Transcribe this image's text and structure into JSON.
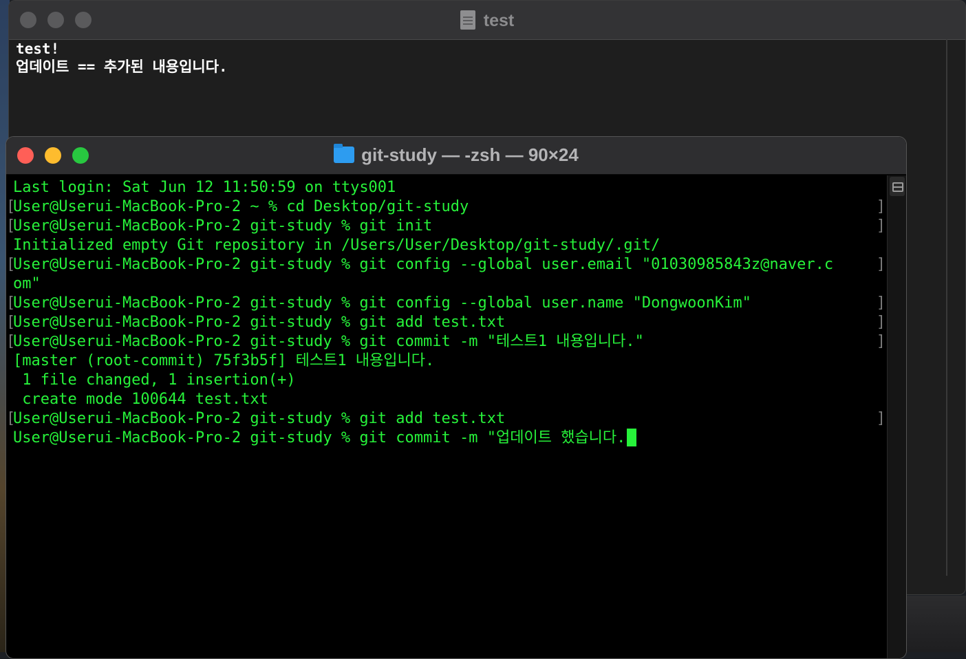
{
  "textedit": {
    "title": "test",
    "lines": [
      "test!",
      "업데이트 == 추가된 내용입니다."
    ]
  },
  "terminal": {
    "title": "git-study — -zsh — 90×24",
    "lines": [
      {
        "text": "Last login: Sat Jun 12 11:50:59 on ttys001",
        "marked": false
      },
      {
        "text": "User@Userui-MacBook-Pro-2 ~ % cd Desktop/git-study",
        "marked": true
      },
      {
        "text": "User@Userui-MacBook-Pro-2 git-study % git init",
        "marked": true
      },
      {
        "text": "Initialized empty Git repository in /Users/User/Desktop/git-study/.git/",
        "marked": false
      },
      {
        "text": "User@Userui-MacBook-Pro-2 git-study % git config --global user.email \"01030985843z@naver.c",
        "marked": true
      },
      {
        "text": "om\"",
        "marked": false
      },
      {
        "text": "User@Userui-MacBook-Pro-2 git-study % git config --global user.name \"DongwoonKim\"",
        "marked": true
      },
      {
        "text": "User@Userui-MacBook-Pro-2 git-study % git add test.txt",
        "marked": true
      },
      {
        "text": "User@Userui-MacBook-Pro-2 git-study % git commit -m \"테스트1 내용입니다.\"",
        "marked": true
      },
      {
        "text": "[master (root-commit) 75f3b5f] 테스트1 내용입니다.",
        "marked": false
      },
      {
        "text": " 1 file changed, 1 insertion(+)",
        "marked": false
      },
      {
        "text": " create mode 100644 test.txt",
        "marked": false
      },
      {
        "text": "User@Userui-MacBook-Pro-2 git-study % git add test.txt",
        "marked": true
      },
      {
        "text": "User@Userui-MacBook-Pro-2 git-study % git commit -m \"업데이트 했습니다.",
        "marked": false,
        "cursor": true
      }
    ]
  },
  "colors": {
    "terminal_text": "#27f23a",
    "terminal_bg": "#000000",
    "close": "#ff5f57",
    "minimize": "#febc2e",
    "zoom": "#28c840"
  }
}
